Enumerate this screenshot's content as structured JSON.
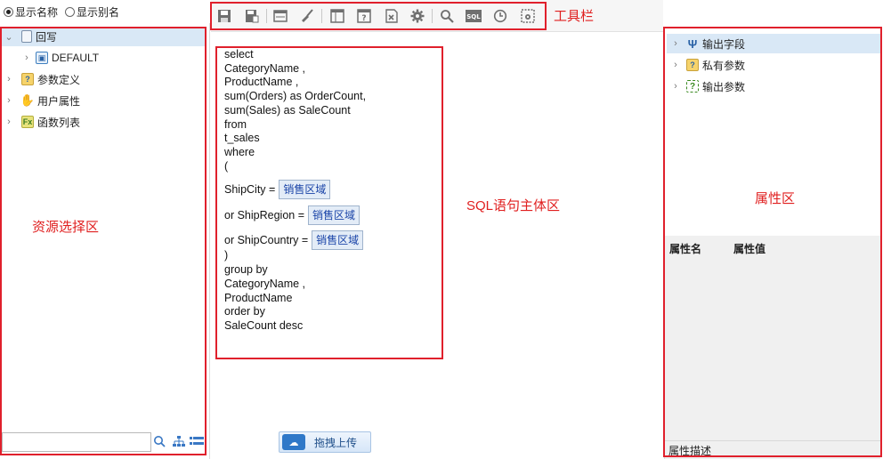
{
  "radio": {
    "show_name": "显示名称",
    "show_alias": "显示别名"
  },
  "resource_tree": {
    "items": [
      {
        "label": "回写"
      },
      {
        "label": "DEFAULT"
      },
      {
        "label": "参数定义"
      },
      {
        "label": "用户属性"
      },
      {
        "label": "函数列表"
      }
    ]
  },
  "annotations": {
    "toolbar": "工具栏",
    "resource_area": "资源选择区",
    "sql_area": "SQL语句主体区",
    "property_area": "属性区"
  },
  "sql": {
    "lines": [
      "select",
      "   CategoryName  ,",
      "   ProductName  ,",
      "   sum(Orders)  as OrderCount,",
      "   sum(Sales) as SaleCount",
      "from",
      "   t_sales",
      "where",
      "   (",
      "      ShipCity  =",
      "      or  ShipRegion  =",
      "      or  ShipCountry =",
      "   )",
      "group by",
      "   CategoryName  ,",
      "   ProductName",
      "order by",
      "   SaleCount desc"
    ],
    "param_tag": "销售区域"
  },
  "upload": {
    "label": "拖拽上传"
  },
  "properties": {
    "tree": [
      {
        "label": "输出字段"
      },
      {
        "label": "私有参数"
      },
      {
        "label": "输出参数"
      }
    ],
    "name_header": "属性名",
    "value_header": "属性值",
    "desc": "属性描述"
  },
  "colors": {
    "annotation_red": "#e0202c",
    "selection": "#d9e8f6",
    "param_tag_text": "#1a44a8"
  }
}
